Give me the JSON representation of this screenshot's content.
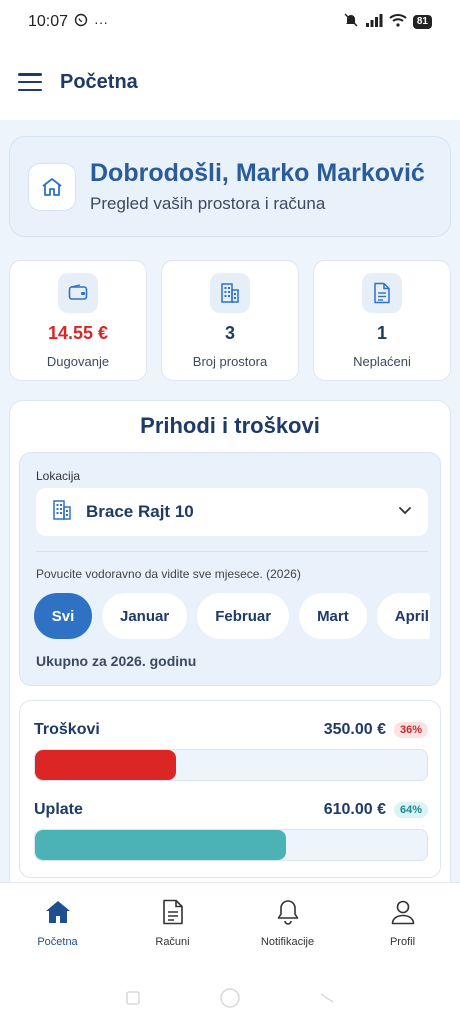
{
  "status_bar": {
    "time": "10:07",
    "battery": "81"
  },
  "app_bar": {
    "title": "Početna"
  },
  "welcome": {
    "title": "Dobrodošli, Marko Marković",
    "subtitle": "Pregled vaših prostora i računa"
  },
  "stats": [
    {
      "value": "14.55 €",
      "label": "Dugovanje",
      "icon": "wallet-icon"
    },
    {
      "value": "3",
      "label": "Broj prostora",
      "icon": "building-icon"
    },
    {
      "value": "1",
      "label": "Neplaćeni",
      "icon": "document-icon"
    }
  ],
  "income_card": {
    "title": "Prihodi i troškovi",
    "location_label": "Lokacija",
    "location_value": "Brace Rajt 10",
    "hint": "Povucite vodoravno da vidite sve mjesece. (2026)",
    "months": [
      "Svi",
      "Januar",
      "Februar",
      "Mart",
      "April"
    ],
    "selected_month": "Svi",
    "year_total": "Ukupno za 2026. godinu",
    "bars": [
      {
        "name": "Troškovi",
        "amount": "350.00 €",
        "percent_label": "36%",
        "fraction": 0.36,
        "color": "#dc2626"
      },
      {
        "name": "Uplate",
        "amount": "610.00 €",
        "percent_label": "64%",
        "fraction": 0.64,
        "color": "#4bb3b5"
      }
    ]
  },
  "bottom_nav": [
    {
      "label": "Početna",
      "icon": "home-icon",
      "active": true
    },
    {
      "label": "Računi",
      "icon": "receipt-icon",
      "active": false
    },
    {
      "label": "Notifikacije",
      "icon": "bell-icon",
      "active": false
    },
    {
      "label": "Profil",
      "icon": "user-icon",
      "active": false
    }
  ],
  "colors": {
    "primary": "#1e3a66",
    "accent": "#2f72c4",
    "debt": "#d62828"
  }
}
